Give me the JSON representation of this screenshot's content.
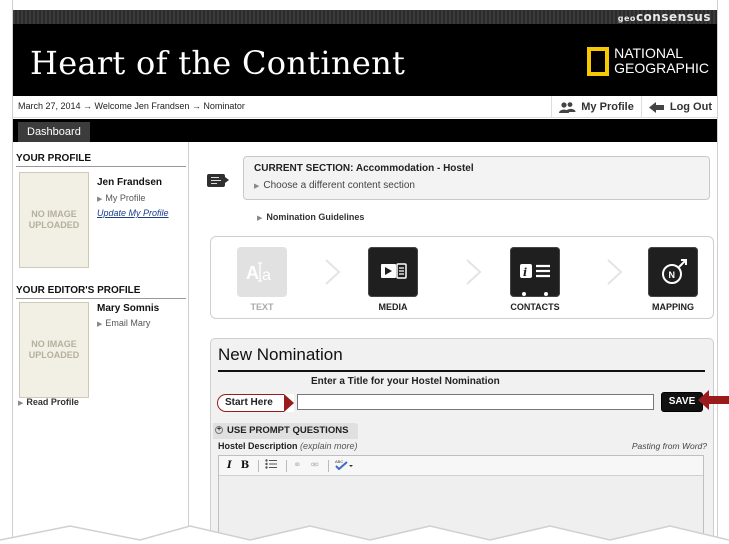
{
  "top_strip": {
    "brand_prefix": "geo",
    "brand": "consensus"
  },
  "header": {
    "site_title": "Heart of the Continent",
    "logo_line1": "NATIONAL",
    "logo_line2": "GEOGRAPHIC"
  },
  "breadcrumb": {
    "text": "March 27, 2014 → Welcome Jen Frandsen → Nominator"
  },
  "user_actions": {
    "profile": "My Profile",
    "logout": "Log Out"
  },
  "tabs": {
    "dashboard": "Dashboard"
  },
  "sidebar": {
    "profile_heading": "YOUR PROFILE",
    "profile_image": "NO IMAGE UPLOADED",
    "profile_name": "Jen Frandsen",
    "profile_link": "My Profile",
    "profile_update": "Update My Profile",
    "editor_heading": "YOUR EDITOR'S PROFILE",
    "editor_image": "NO IMAGE UPLOADED",
    "editor_name": "Mary Somnis",
    "editor_link": "Email Mary",
    "read_profile": "Read Profile"
  },
  "section": {
    "title": "CURRENT SECTION: Accommodation - Hostel",
    "change": "Choose a different content section",
    "guidelines": "Nomination Guidelines"
  },
  "steps": [
    {
      "label": "TEXT",
      "icon": "text-edit-icon",
      "active": false
    },
    {
      "label": "MEDIA",
      "icon": "media-icon",
      "active": true
    },
    {
      "label": "CONTACTS",
      "icon": "contacts-icon",
      "active": true
    },
    {
      "label": "MAPPING",
      "icon": "compass-icon",
      "active": true
    }
  ],
  "nomination": {
    "heading": "New Nomination",
    "title_hint": "Enter a Title for your Hostel Nomination",
    "start_here": "Start Here",
    "title_value": "",
    "save": "SAVE",
    "prompt_toggle": "USE PROMPT QUESTIONS",
    "desc_label": "Hostel Description",
    "desc_hint": "(explain more)",
    "paste_word": "Pasting from Word?"
  },
  "colors": {
    "accent_red": "#9b1b1b",
    "header_bg": "#000000",
    "natgeo_yellow": "#f7c900"
  }
}
